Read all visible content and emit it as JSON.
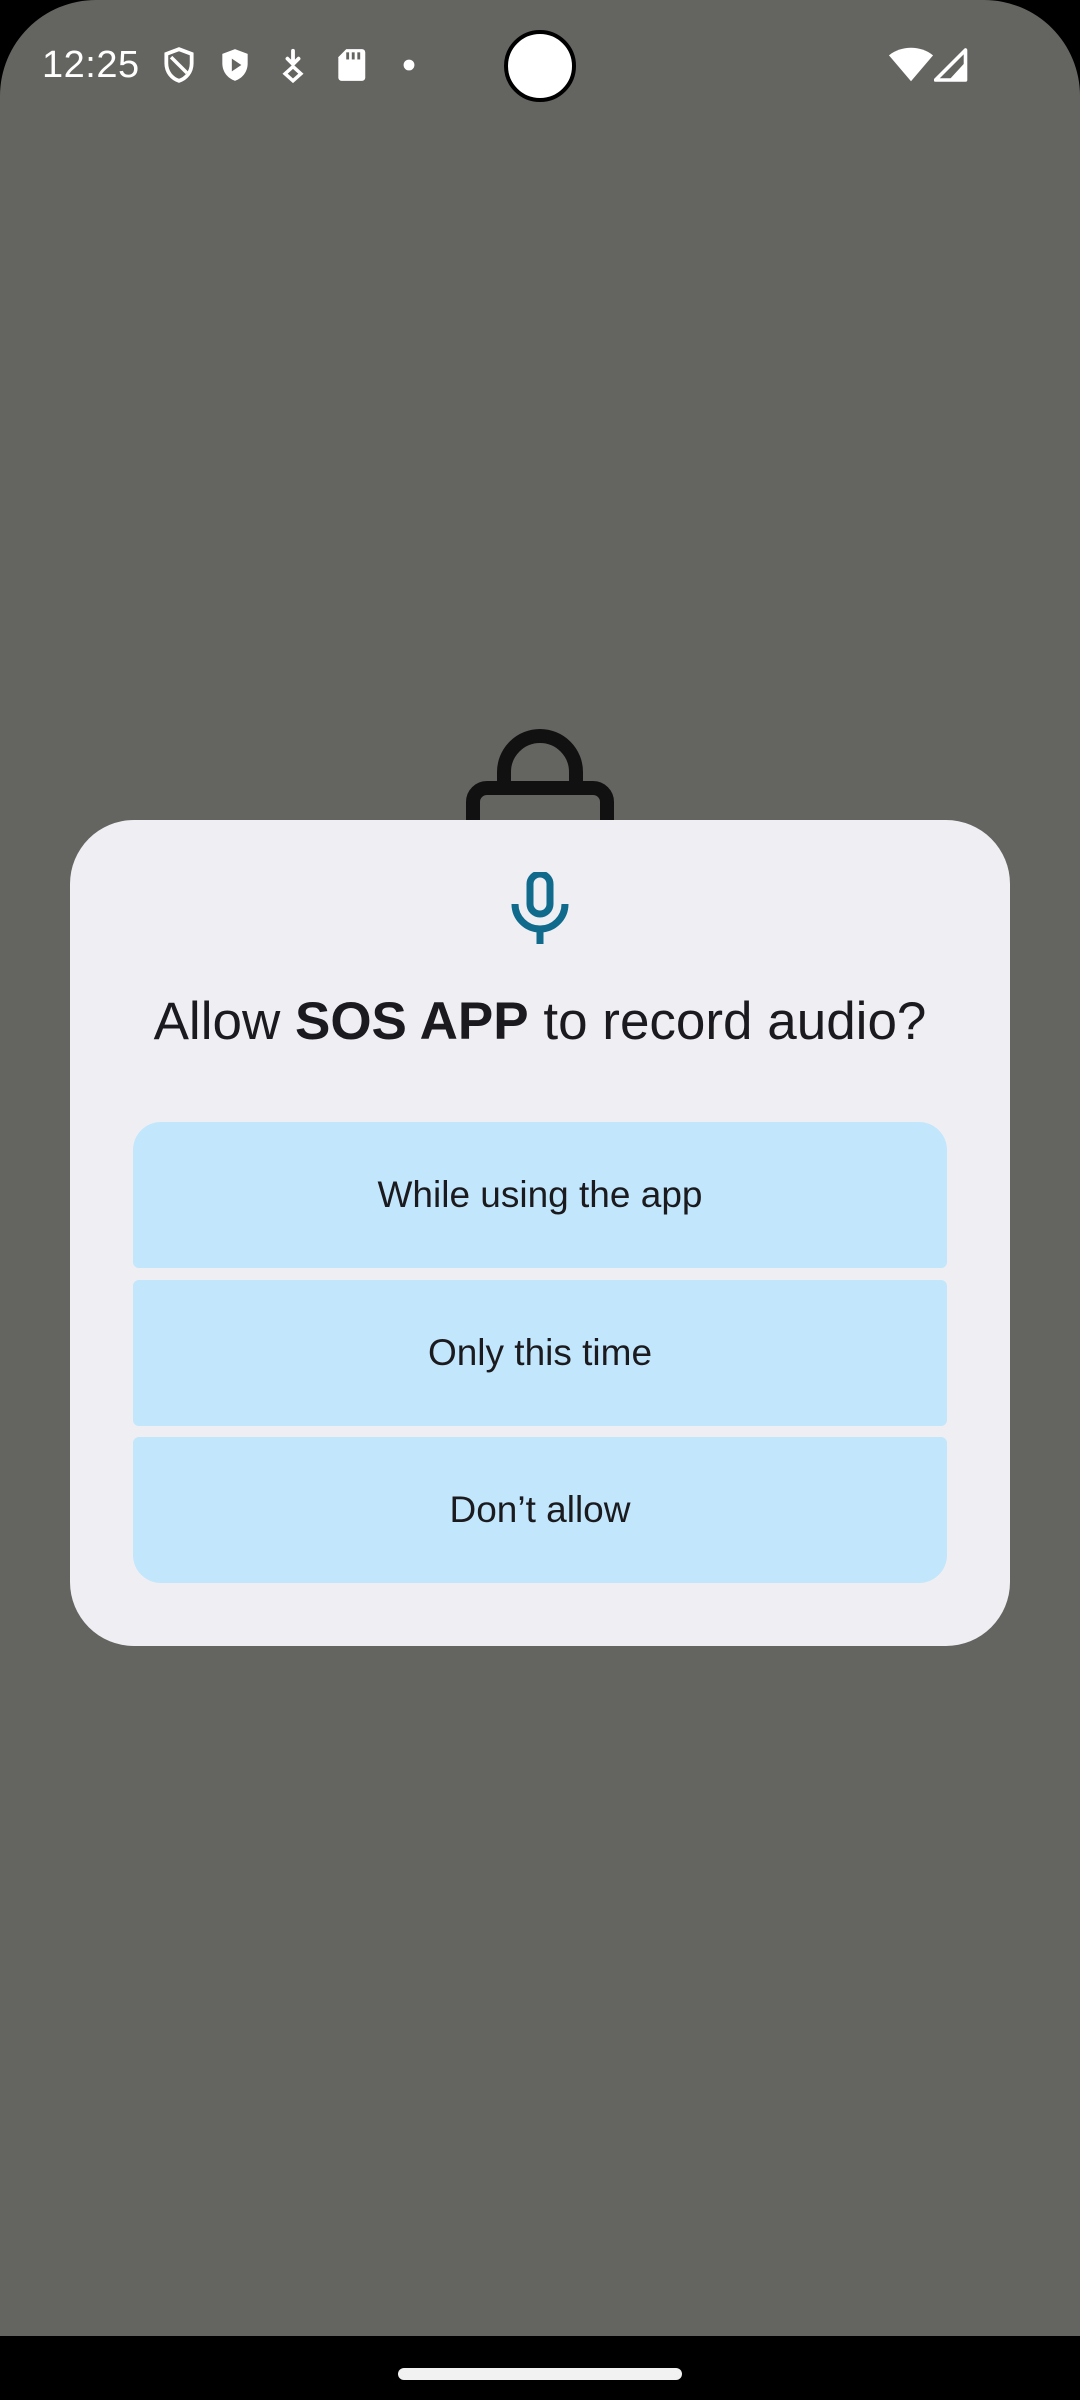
{
  "status_bar": {
    "time": "12:25",
    "icons": [
      "shield-outline-icon",
      "shield-play-icon",
      "download-badge-icon",
      "sd-card-icon",
      "dot-icon",
      "wifi-icon",
      "cell-signal-icon"
    ]
  },
  "background": {
    "illustration": "lock-icon"
  },
  "dialog": {
    "icon": "microphone-icon",
    "title_prefix": "Allow ",
    "app_name": "SOS APP",
    "title_suffix": " to record audio?",
    "buttons": [
      {
        "label": "While using the app"
      },
      {
        "label": "Only this time"
      },
      {
        "label": "Don’t allow"
      }
    ]
  },
  "colors": {
    "scrim": "#646460",
    "dialog_bg": "#efeff3",
    "button_bg": "#c2e6fb",
    "icon_accent": "#0f6a8c",
    "text": "#1b1b1f"
  }
}
